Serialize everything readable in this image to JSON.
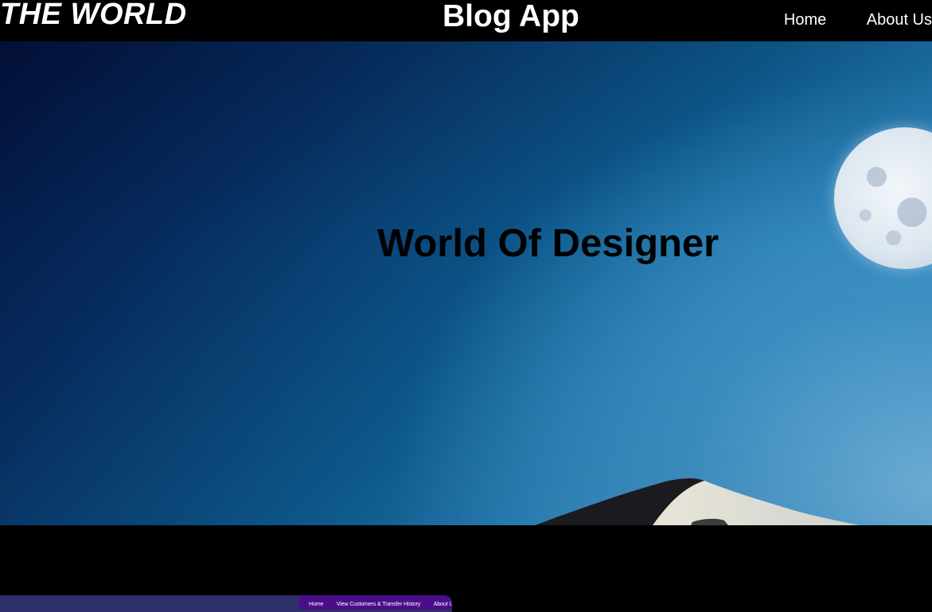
{
  "header": {
    "brand": "THE WORLD",
    "app_title": "Blog App",
    "nav": [
      {
        "label": "Home"
      },
      {
        "label": "About Us"
      }
    ]
  },
  "hero": {
    "heading": "World Of Designer"
  },
  "embedded_nav": {
    "items": [
      {
        "label": "Home"
      },
      {
        "label": "View Customers & Transfer History"
      },
      {
        "label": "About Us"
      }
    ]
  },
  "colors": {
    "header_bg": "#000000",
    "header_text": "#ffffff",
    "hero_heading": "#000000",
    "embedded_strip": "#2e2f6b",
    "embedded_nav_bg": "#4b0e8a"
  }
}
